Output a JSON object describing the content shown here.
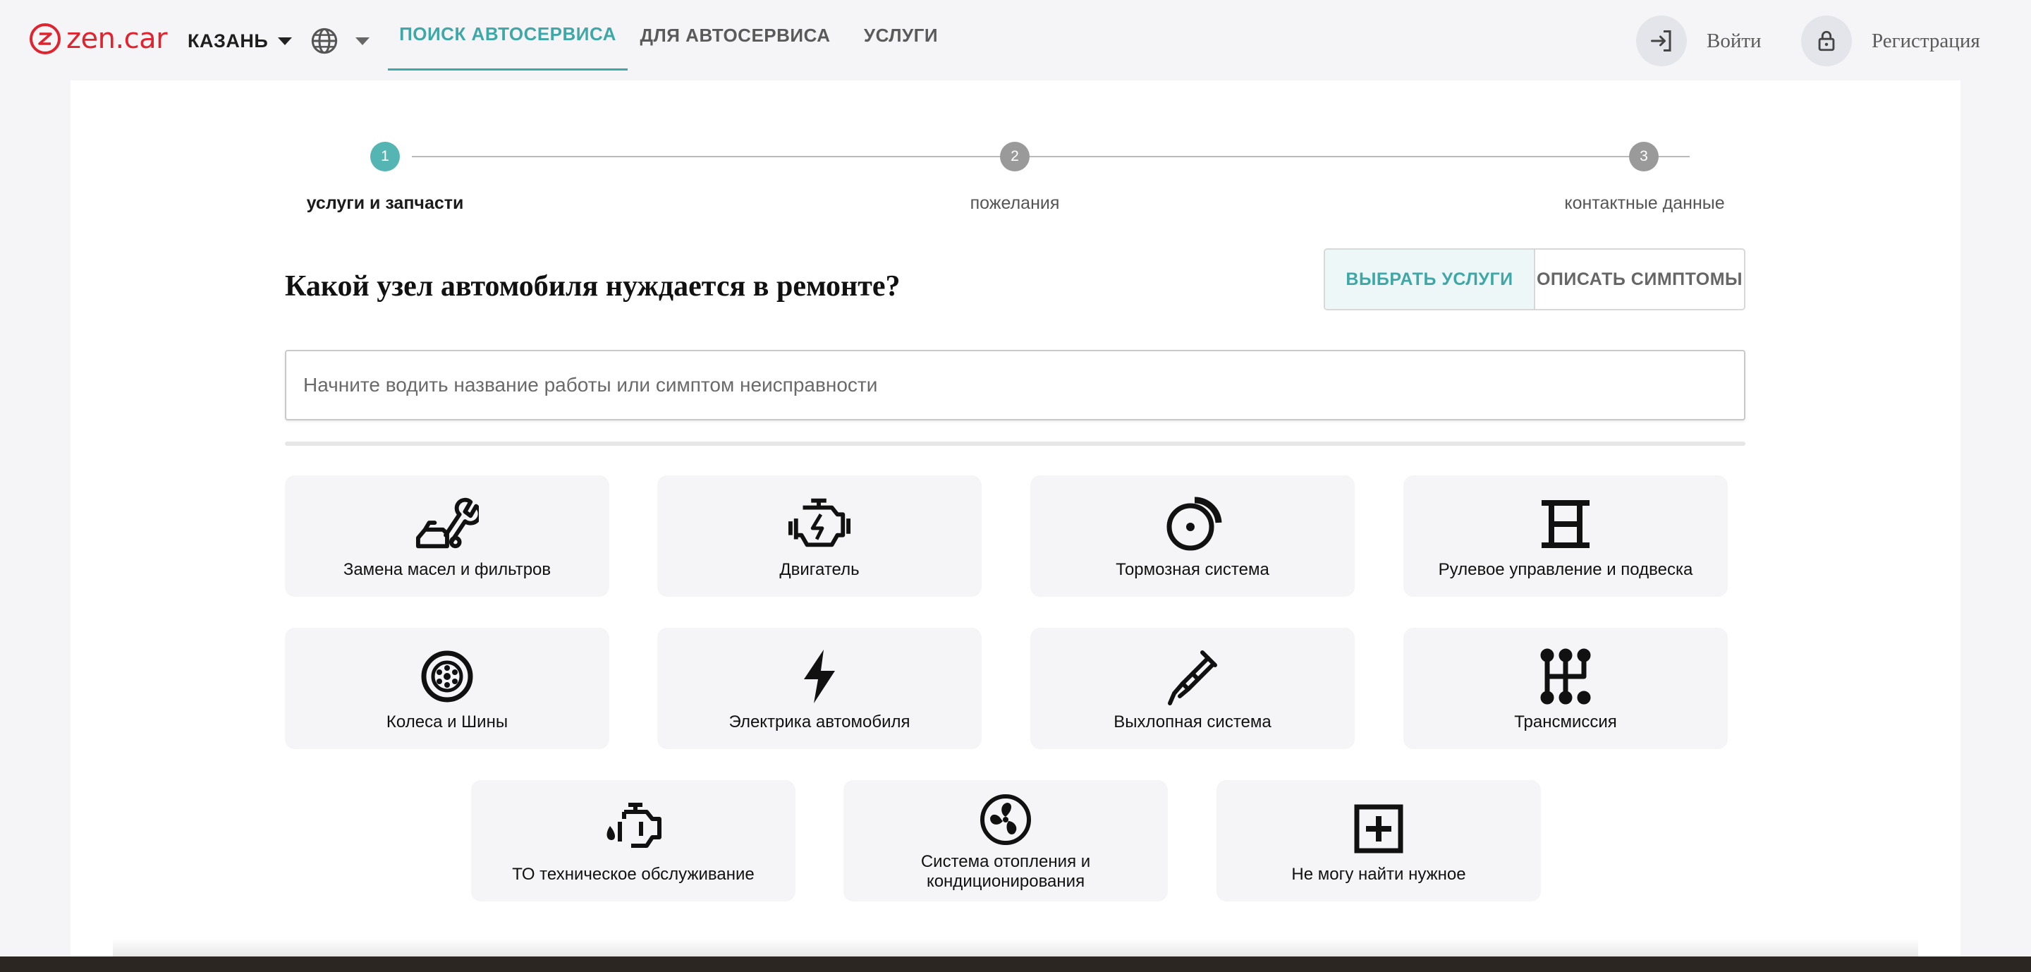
{
  "header": {
    "logo_text": "zen.car",
    "city": "КАЗАНЬ",
    "nav": [
      {
        "label": "ПОИСК АВТОСЕРВИСА",
        "active": true
      },
      {
        "label": "ДЛЯ АВТОСЕРВИСА",
        "active": false
      },
      {
        "label": "УСЛУГИ",
        "active": false
      }
    ],
    "login_label": "Войти",
    "register_label": "Регистрация",
    "accent_color": "#3fa7a7",
    "brand_color": "#e0242f"
  },
  "stepper": {
    "steps": [
      {
        "number": "1",
        "label": "услуги и запчасти",
        "active": true
      },
      {
        "number": "2",
        "label": "пожелания",
        "active": false
      },
      {
        "number": "3",
        "label": "контактные данные",
        "active": false
      }
    ]
  },
  "main": {
    "question": "Какой узел автомобиля нуждается в ремонте?",
    "toggle": {
      "services_label": "ВЫБРАТЬ УСЛУГИ",
      "symptoms_label": "ОПИСАТЬ СИМПТОМЫ",
      "selected": "services"
    },
    "search_placeholder": "Начните водить название работы или симптом неисправности",
    "categories": [
      {
        "label": "Замена масел и фильтров",
        "icon": "oil-wrench-icon"
      },
      {
        "label": "Двигатель",
        "icon": "engine-icon"
      },
      {
        "label": "Тормозная система",
        "icon": "brake-disc-icon"
      },
      {
        "label": "Рулевое управление и подвеска",
        "icon": "suspension-icon"
      },
      {
        "label": "Колеса и Шины",
        "icon": "wheel-icon"
      },
      {
        "label": "Электрика автомобиля",
        "icon": "lightning-icon"
      },
      {
        "label": "Выхлопная система",
        "icon": "exhaust-icon"
      },
      {
        "label": "Трансмиссия",
        "icon": "gearbox-icon"
      },
      {
        "label": "ТО техническое обслуживание",
        "icon": "oil-can-icon"
      },
      {
        "label": "Система отопления и кондиционирования",
        "icon": "fan-icon"
      },
      {
        "label": "Не могу найти нужное",
        "icon": "plus-box-icon"
      }
    ]
  }
}
